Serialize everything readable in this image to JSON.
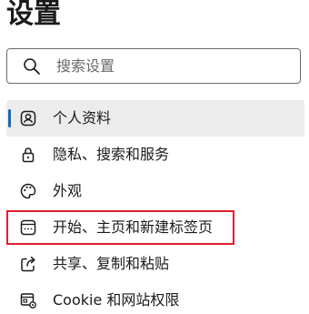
{
  "header": {
    "title": "设置"
  },
  "search": {
    "placeholder": "搜索设置",
    "icon": "search-icon"
  },
  "accent_color": "#0f6cbd",
  "highlight_color": "#e01e2f",
  "sidebar": {
    "items": [
      {
        "label": "个人资料",
        "icon": "profile-icon",
        "selected": true
      },
      {
        "label": "隐私、搜索和服务",
        "icon": "lock-icon",
        "selected": false
      },
      {
        "label": "外观",
        "icon": "palette-icon",
        "selected": false
      },
      {
        "label": "开始、主页和新建标签页",
        "icon": "start-page-icon",
        "selected": false,
        "highlighted": true
      },
      {
        "label": "共享、复制和粘贴",
        "icon": "share-icon",
        "selected": false
      },
      {
        "label": "Cookie 和网站权限",
        "icon": "site-permissions-icon",
        "selected": false
      }
    ]
  }
}
